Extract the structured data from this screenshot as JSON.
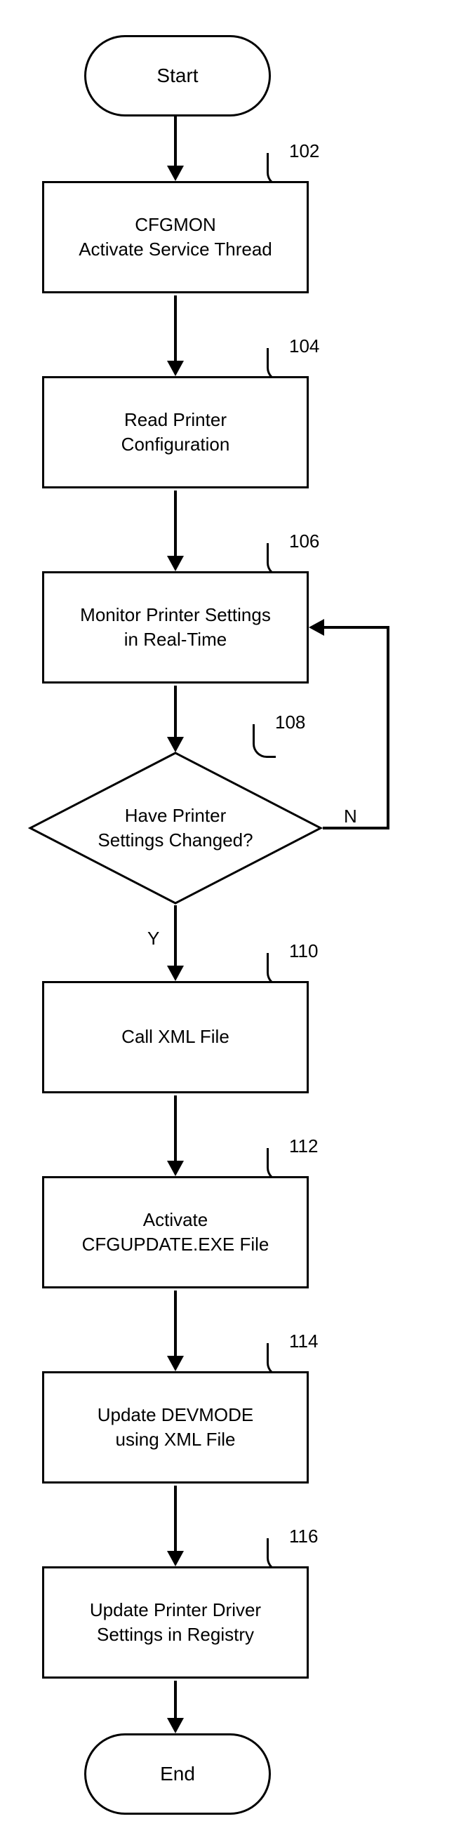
{
  "start": "Start",
  "end": "End",
  "steps": {
    "s102": {
      "ref": "102",
      "text": "CFGMON\nActivate Service Thread"
    },
    "s104": {
      "ref": "104",
      "text": "Read Printer\nConfiguration"
    },
    "s106": {
      "ref": "106",
      "text": "Monitor Printer Settings\nin Real-Time"
    },
    "s108": {
      "ref": "108",
      "text": "Have Printer\nSettings Changed?"
    },
    "s110": {
      "ref": "110",
      "text": "Call XML File"
    },
    "s112": {
      "ref": "112",
      "text": "Activate\nCFGUPDATE.EXE File"
    },
    "s114": {
      "ref": "114",
      "text": "Update DEVMODE\nusing XML File"
    },
    "s116": {
      "ref": "116",
      "text": "Update Printer Driver\nSettings in Registry"
    }
  },
  "labels": {
    "yes": "Y",
    "no": "N"
  }
}
